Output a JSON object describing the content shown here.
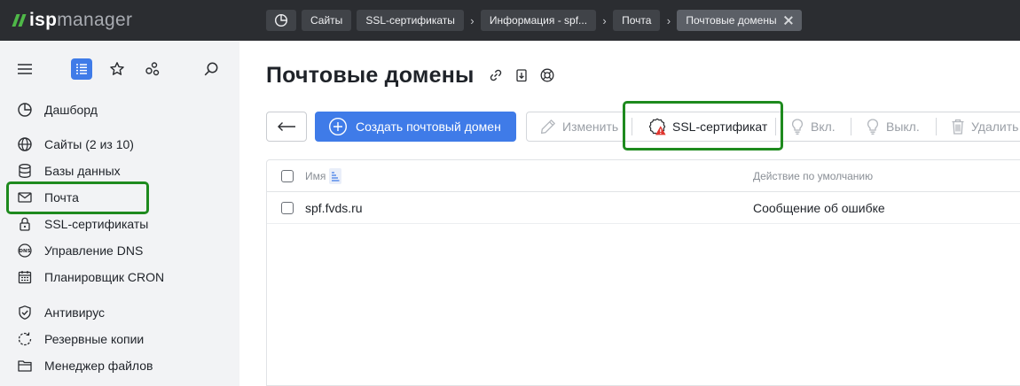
{
  "app": {
    "logo_isp": "isp",
    "logo_manager": "manager",
    "brand_color": "#4fb848"
  },
  "breadcrumbs": [
    {
      "label": "Сайты"
    },
    {
      "label": "SSL-сертификаты"
    },
    {
      "label": "Информация - spf..."
    },
    {
      "label": "Почта"
    },
    {
      "label": "Почтовые домены",
      "active": true
    }
  ],
  "sidebar": {
    "tools": [
      "menu-icon",
      "list-view-icon",
      "star-icon",
      "share-icon",
      "search-icon"
    ],
    "items": [
      {
        "label": "Дашборд",
        "icon": "dashboard-icon"
      },
      {
        "label": "Сайты (2 из 10)",
        "icon": "globe-icon"
      },
      {
        "label": "Базы данных",
        "icon": "database-icon"
      },
      {
        "label": "Почта",
        "icon": "mail-icon",
        "highlighted": true
      },
      {
        "label": "SSL-сертификаты",
        "icon": "lock-icon"
      },
      {
        "label": "Управление DNS",
        "icon": "dns-icon"
      },
      {
        "label": "Планировщик CRON",
        "icon": "calendar-icon"
      },
      {
        "label": "Антивирус",
        "icon": "shield-icon"
      },
      {
        "label": "Резервные копии",
        "icon": "backup-icon"
      },
      {
        "label": "Менеджер файлов",
        "icon": "folder-icon"
      }
    ],
    "dns_icon_text": "DNS"
  },
  "main": {
    "title": "Почтовые домены",
    "create_button": "Создать почтовый домен",
    "toolbar": {
      "edit": "Изменить",
      "ssl": "SSL-сертификат",
      "enable": "Вкл.",
      "disable": "Выкл.",
      "delete": "Удалить"
    },
    "table": {
      "columns": [
        "Имя",
        "Действие по умолчанию"
      ],
      "rows": [
        {
          "name": "spf.fvds.ru",
          "action": "Сообщение об ошибке"
        }
      ]
    }
  },
  "colors": {
    "accent": "#3f7be8",
    "highlight": "#1e8a1e",
    "warning": "#e0362f"
  }
}
